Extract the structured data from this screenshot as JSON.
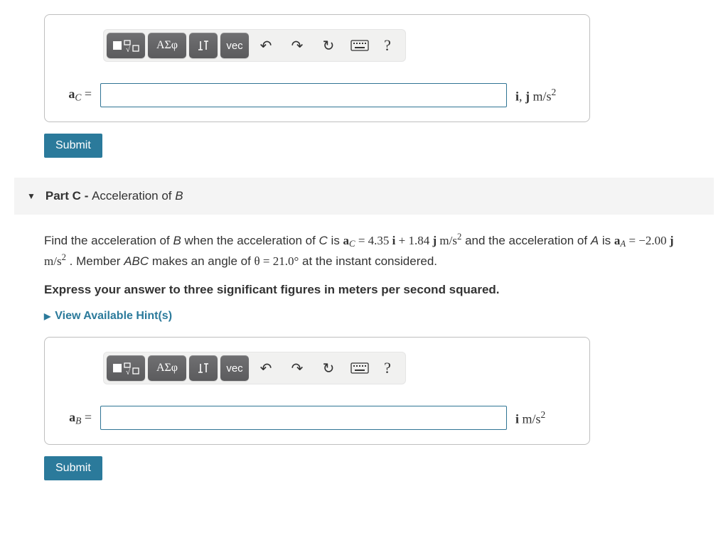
{
  "toolbar": {
    "templates_label": "",
    "sqrt_label": "",
    "greek_label": "ΑΣφ",
    "subsup_label": "",
    "vec_label": "vec",
    "undo_label": "↶",
    "redo_label": "↷",
    "reset_label": "↻",
    "keyboard_label": "",
    "help_label": "?"
  },
  "sectionB": {
    "label_var": "a",
    "label_sub": "C",
    "label_eq": " =",
    "unit_prefix_i": "i",
    "unit_comma": ", ",
    "unit_prefix_j": "j",
    "unit_space": " ",
    "unit_base": "m/s",
    "unit_exp": "2",
    "submit": "Submit"
  },
  "partC": {
    "header_part": "Part C",
    "header_sep": " - ",
    "header_title_pre": "Acceleration of ",
    "header_title_var": "B",
    "prompt": {
      "t1": "Find the acceleration of ",
      "v1": "B",
      "t2": " when the acceleration of ",
      "v2": "C",
      "t3": " is ",
      "ac_var": "a",
      "ac_sub": "C",
      "ac_eq": " = 4.35 ",
      "ac_i": "i",
      "ac_plus": " + 1.84 ",
      "ac_j": "j",
      "ac_sp": " ",
      "ac_unit": "m/s",
      "ac_exp": "2",
      "t4": " and the acceleration of ",
      "v3": "A",
      "t5": " is ",
      "aa_var": "a",
      "aa_sub": "A",
      "aa_eq": " = −2.00 ",
      "aa_j": "j",
      "aa_sp": " ",
      "aa_unit": "m/s",
      "aa_exp": "2",
      "t6": " . Member ",
      "v4": "ABC",
      "t7": " makes an angle of ",
      "theta": "θ = 21.0°",
      "t8": " at the instant considered."
    },
    "express": "Express your answer to three significant figures in meters per second squared.",
    "hints": "View Available Hint(s)",
    "label_var": "a",
    "label_sub": "B",
    "label_eq": " =",
    "unit_prefix_i": "i",
    "unit_space": " ",
    "unit_base": "m/s",
    "unit_exp": "2",
    "submit": "Submit"
  }
}
